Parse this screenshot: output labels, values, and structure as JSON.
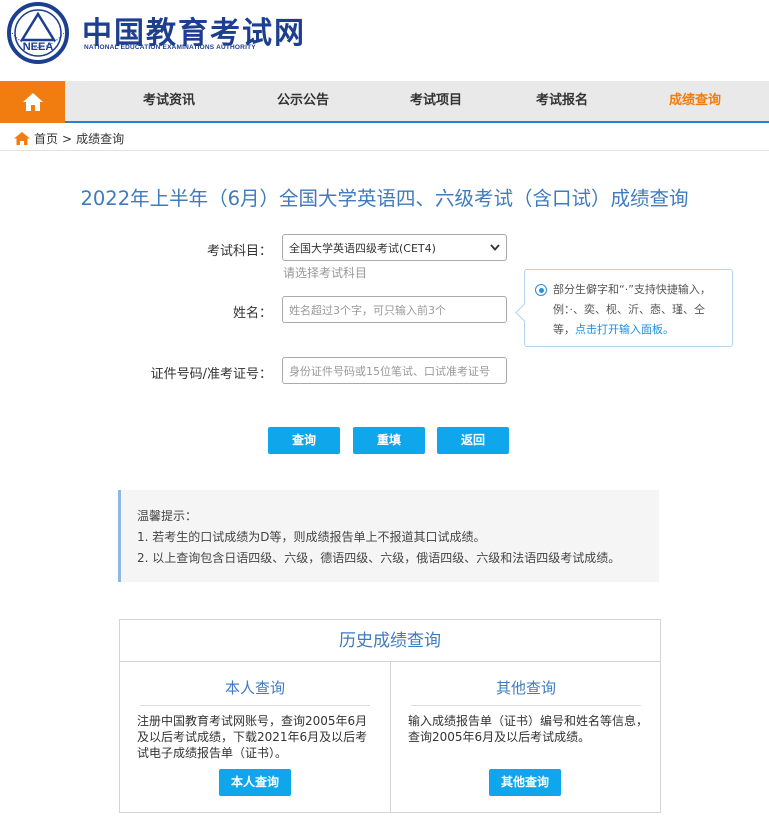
{
  "header": {
    "title": "中国教育考试网",
    "subtitle": "NATIONAL EDUCATION EXAMINATIONS AUTHORITY",
    "logo_text": "NEEA"
  },
  "nav": {
    "items": [
      {
        "label": "考试资讯"
      },
      {
        "label": "公示公告"
      },
      {
        "label": "考试项目"
      },
      {
        "label": "考试报名"
      },
      {
        "label": "成绩查询"
      }
    ]
  },
  "breadcrumb": {
    "home": "首页",
    "separator": ">",
    "current": "成绩查询"
  },
  "page_title": "2022年上半年（6月）全国大学英语四、六级考试（含口试）成绩查询",
  "form": {
    "subject_label": "考试科目：",
    "subject_value": "全国大学英语四级考试(CET4)",
    "subject_hint": "请选择考试科目",
    "name_label": "姓名：",
    "name_placeholder": "姓名超过3个字，可只输入前3个",
    "id_label": "证件号码/准考证号：",
    "id_placeholder": "身份证件号码或15位笔试、口试准考证号"
  },
  "tip": {
    "text": "部分生僻字和“·”支持快捷输入，例：·、奕、枧、沂、悫、瑾、仝等，",
    "link": "点击打开输入面板。"
  },
  "buttons": {
    "query": "查询",
    "reset": "重填",
    "back": "返回"
  },
  "notice": {
    "title": "温馨提示：",
    "items": [
      "1. 若考生的口试成绩为D等，则成绩报告单上不报道其口试成绩。",
      "2. 以上查询包含日语四级、六级，德语四级、六级，俄语四级、六级和法语四级考试成绩。"
    ]
  },
  "history": {
    "title": "历史成绩查询",
    "self": {
      "title": "本人查询",
      "text": "注册中国教育考试网账号，查询2005年6月及以后考试成绩，下载2021年6月及以后考试电子成绩报告单（证书）。",
      "button": "本人查询"
    },
    "other": {
      "title": "其他查询",
      "text": "输入成绩报告单（证书）编号和姓名等信息，查询2005年6月及以后考试成绩。",
      "button": "其他查询"
    }
  },
  "colors": {
    "accent": "#f17d10",
    "primary": "#10a6ec",
    "title": "#3e7bbf",
    "brand": "#1d3f8f"
  }
}
